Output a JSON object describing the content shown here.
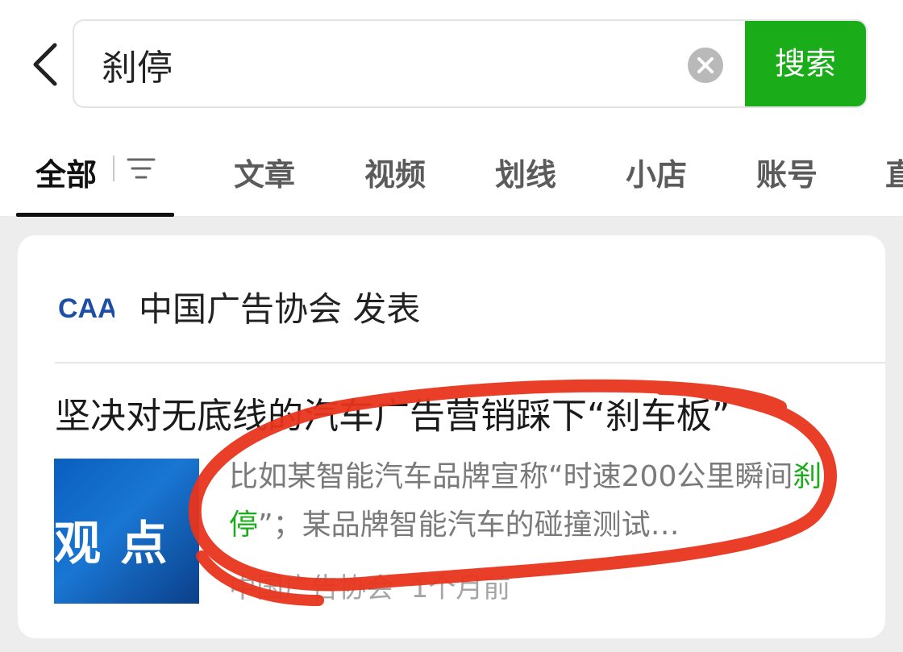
{
  "search": {
    "query": "刹停",
    "button_label": "搜索"
  },
  "tabs": [
    "全部",
    "文章",
    "视频",
    "划线",
    "小店",
    "账号",
    "直"
  ],
  "card": {
    "publisher": "中国广告协会 发表",
    "logo_text": "CAA",
    "title": "坚决对无底线的汽车广告营销踩下“刹车板”",
    "thumbnail_text": "观 点",
    "snippet_before": "比如某智能汽车品牌宣称“时速200公里瞬间",
    "snippet_highlight": "刹停",
    "snippet_after": "”；某品牌智能汽车的碰撞测试…",
    "source": "中国广告协会",
    "time": "1个月前"
  },
  "colors": {
    "accent": "#1aad19",
    "annotation": "#e8341c"
  }
}
